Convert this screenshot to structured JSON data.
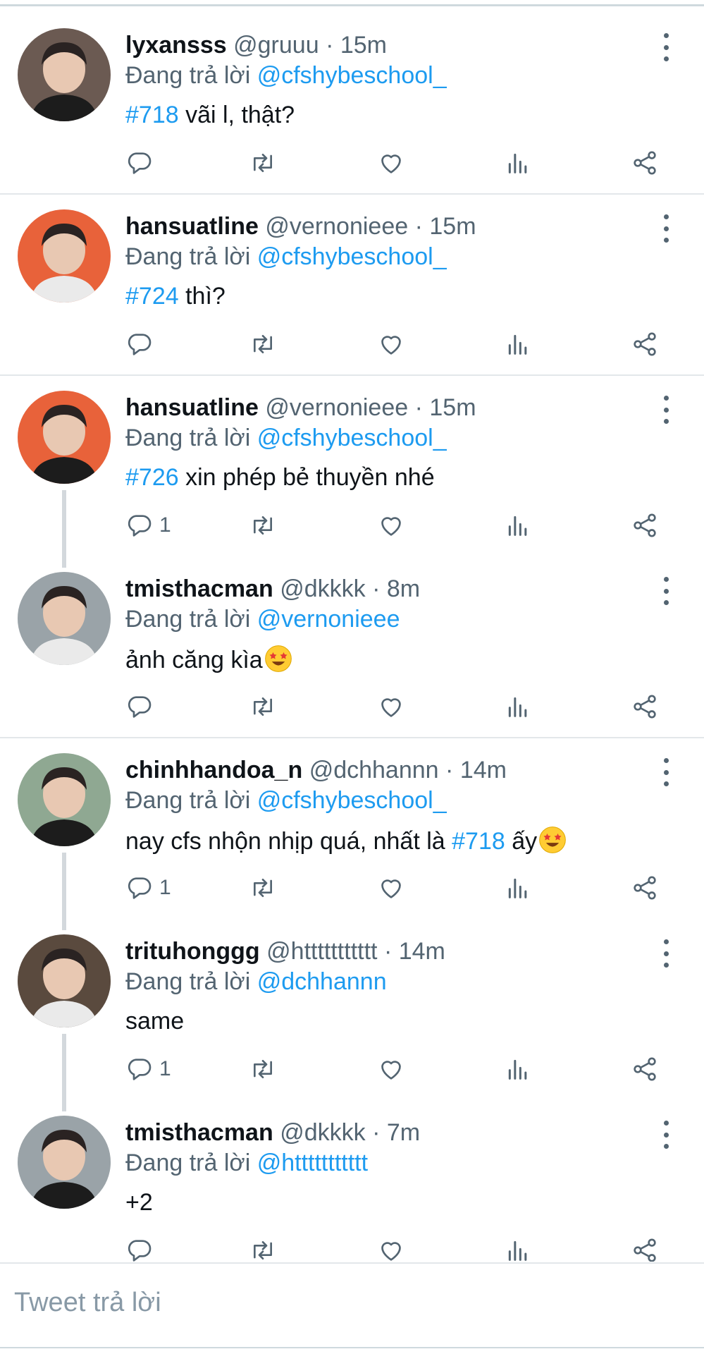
{
  "tweets": [
    {
      "name": "lyxansss",
      "handle": "@gruuu",
      "time": "15m",
      "replying_label": "Đang trả lời",
      "replying_to": "@cfshybeschool_",
      "tag": "#718",
      "text": " vãi l, thật?",
      "text_after_tag": "",
      "reply_count": "",
      "avatar_color": "#6b5a52",
      "separator": true,
      "thread": false,
      "emoji": false
    },
    {
      "name": "hansuatline",
      "handle": "@vernonieee",
      "time": "15m",
      "replying_label": "Đang trả lời",
      "replying_to": "@cfshybeschool_",
      "tag": "#724",
      "text": " thì?",
      "text_after_tag": "",
      "reply_count": "",
      "avatar_color": "#e8623a",
      "separator": true,
      "thread": false,
      "emoji": false
    },
    {
      "name": "hansuatline",
      "handle": "@vernonieee",
      "time": "15m",
      "replying_label": "Đang trả lời",
      "replying_to": "@cfshybeschool_",
      "tag": "#726",
      "text": " xin phép bẻ thuyền nhé",
      "text_after_tag": "",
      "reply_count": "1",
      "avatar_color": "#e8623a",
      "separator": false,
      "thread": true,
      "emoji": false
    },
    {
      "name": "tmisthacman",
      "handle": "@dkkkk",
      "time": "8m",
      "replying_label": "Đang trả lời",
      "replying_to": "@vernonieee",
      "tag": "",
      "text": "ảnh căng kìa",
      "text_after_tag": "",
      "reply_count": "",
      "avatar_color": "#9aa3a8",
      "separator": true,
      "thread": false,
      "emoji": true
    },
    {
      "name": "chinhhandoa_n",
      "handle": "@dchhannn",
      "time": "14m",
      "replying_label": "Đang trả lời",
      "replying_to": "@cfshybeschool_",
      "tag": "#718",
      "text": "nay cfs nhộn nhịp quá, nhất là ",
      "text_after_tag": " ấy",
      "reply_count": "1",
      "avatar_color": "#8fa892",
      "separator": false,
      "thread": true,
      "emoji": true
    },
    {
      "name": "trituhonggg",
      "handle": "@httttttttttt",
      "time": "14m",
      "replying_label": "Đang trả lời",
      "replying_to": "@dchhannn",
      "tag": "",
      "text": "same",
      "text_after_tag": "",
      "reply_count": "1",
      "avatar_color": "#5a4a3e",
      "separator": false,
      "thread": true,
      "emoji": false
    },
    {
      "name": "tmisthacman",
      "handle": "@dkkkk",
      "time": "7m",
      "replying_label": "Đang trả lời",
      "replying_to": "@httttttttttt",
      "tag": "",
      "text": "+2",
      "text_after_tag": "",
      "reply_count": "",
      "avatar_color": "#9aa3a8",
      "separator": false,
      "thread": false,
      "emoji": false
    }
  ],
  "reply_box": {
    "placeholder": "Tweet trả lời"
  },
  "icons": {
    "reply": "reply-icon",
    "retweet": "retweet-icon",
    "like": "heart-icon",
    "views": "views-icon",
    "share": "share-icon",
    "more": "more-icon",
    "emoji": "star-struck-emoji"
  },
  "colors": {
    "link": "#1d9bf0",
    "muted": "#536471",
    "text": "#0f1419",
    "divider": "#e3e7ea"
  }
}
